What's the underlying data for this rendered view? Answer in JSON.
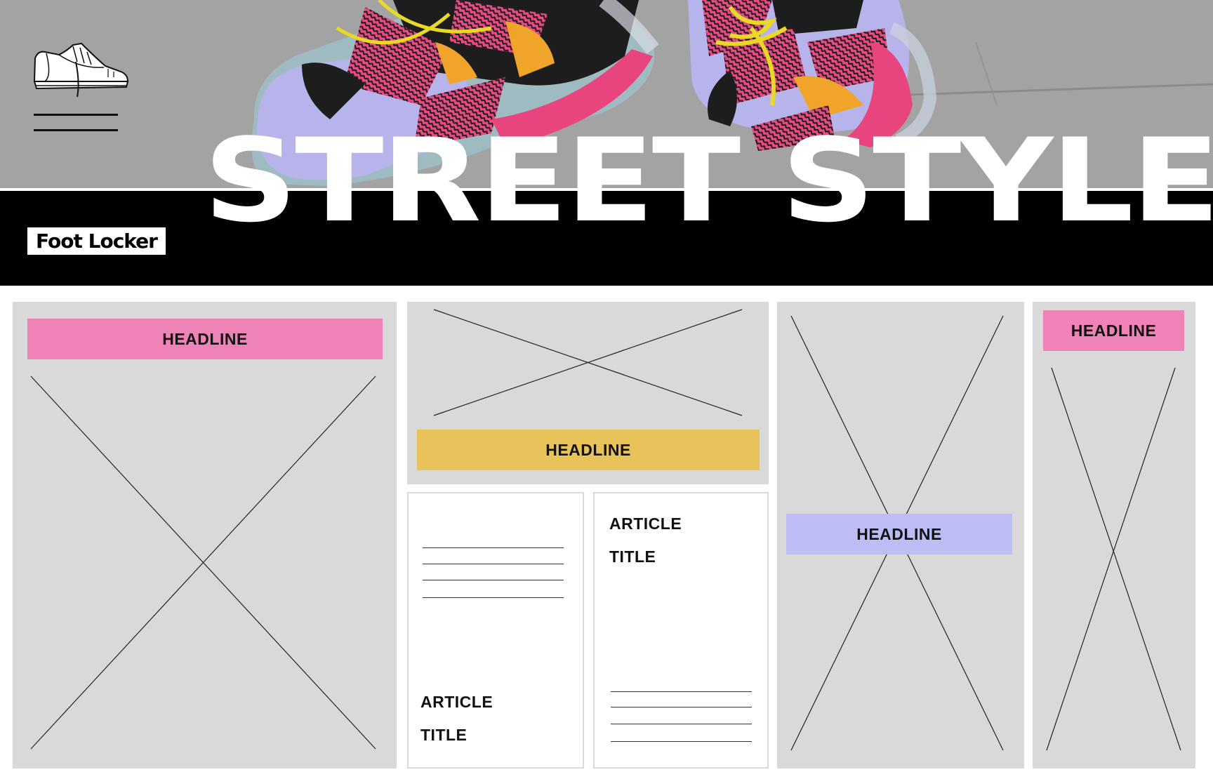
{
  "hero": {
    "title": "STREET STYLE",
    "image": "sneaker-street-photo"
  },
  "brand": {
    "logo_text": "Foot Locker"
  },
  "icons": {
    "menu": "menu-icon",
    "shoe": "sneaker-icon"
  },
  "colors": {
    "pink": "#ee83b7",
    "yellow": "#e7c35a",
    "lavender": "#bdbdf6",
    "placeholder_gray": "#d9d9d9",
    "black": "#000000"
  },
  "cards": {
    "card1": {
      "headline": "HEADLINE"
    },
    "card2": {
      "headline": "HEADLINE"
    },
    "card3": {
      "headline": "HEADLINE"
    },
    "card4": {
      "headline": "HEADLINE"
    },
    "article1": {
      "title_line1": "ARTICLE",
      "title_line2": "TITLE"
    },
    "article2": {
      "title_line1": "ARTICLE",
      "title_line2": "TITLE"
    }
  }
}
